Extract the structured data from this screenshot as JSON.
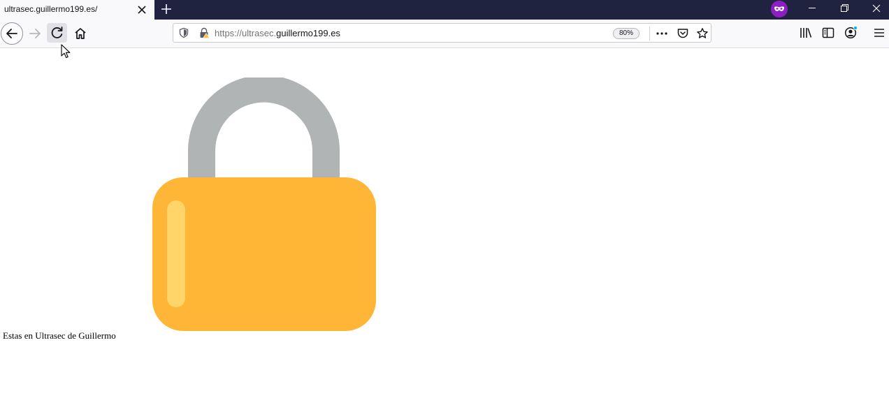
{
  "browser": {
    "tab": {
      "title": "ultrasec.guillermo199.es/"
    },
    "url": {
      "prefix": "https://ultrasec.",
      "domain": "guillermo199.es"
    },
    "zoom": "80%",
    "private_browsing": true,
    "colors": {
      "tabbar": "#202340",
      "toolbar": "#f9f9fb",
      "private_badge": "#8c1ec2",
      "account_dot": "#00b3f4"
    }
  },
  "page": {
    "image": {
      "icon": "padlock-icon",
      "body_color": "#ffb636",
      "shackle_color": "#b0b4b5",
      "highlight_color": "#ffd469"
    },
    "text": "Estas en Ultrasec de Guillermo"
  }
}
